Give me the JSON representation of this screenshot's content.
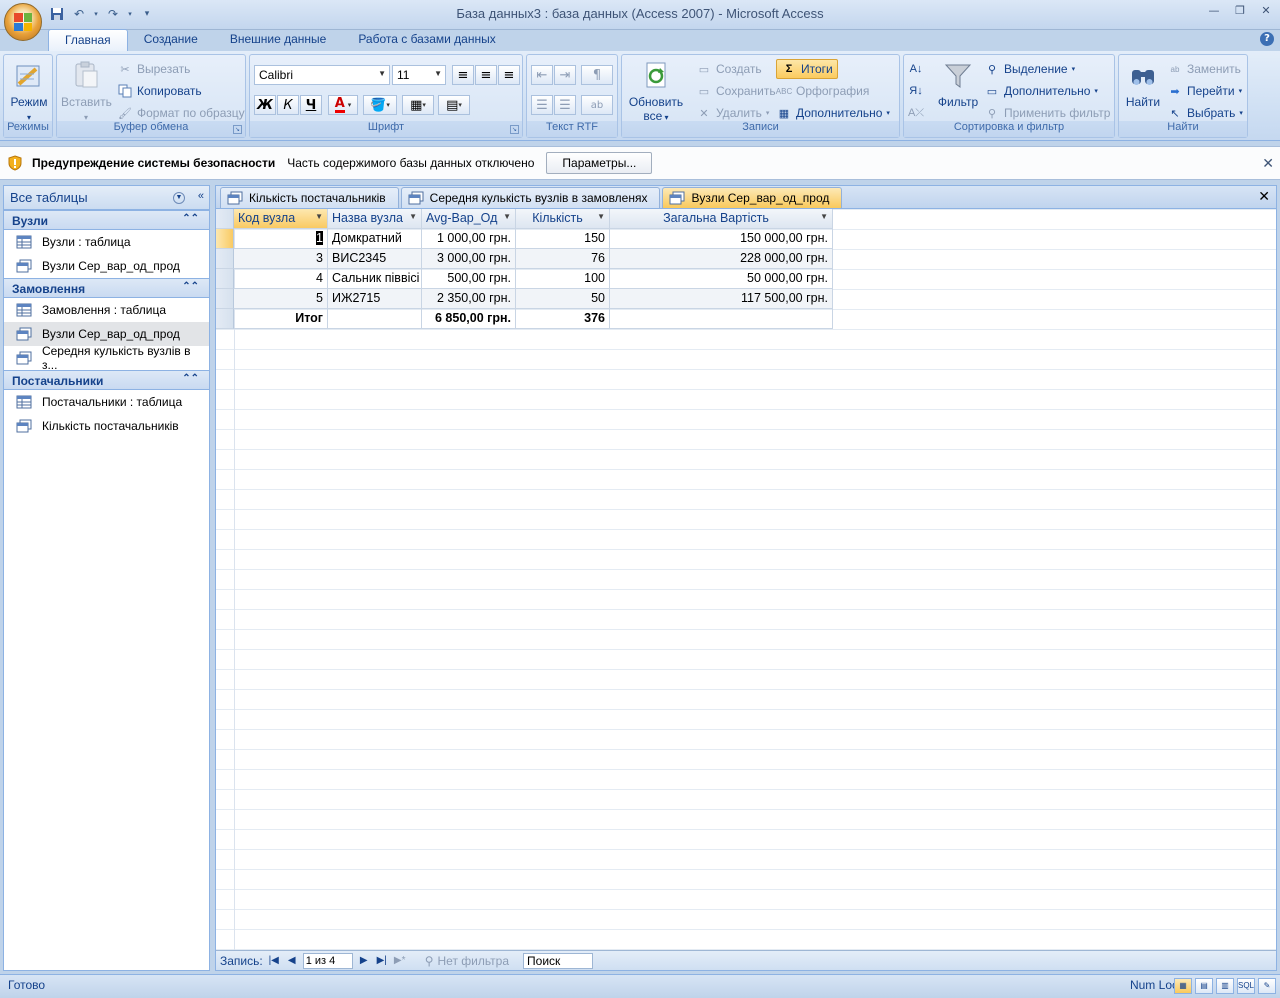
{
  "window": {
    "title": "База данных3 : база данных (Access 2007) - Microsoft Access"
  },
  "ribbon_tabs": [
    "Главная",
    "Создание",
    "Внешние данные",
    "Работа с базами данных"
  ],
  "ribbon": {
    "modes": {
      "view": "Режим",
      "title": "Режимы"
    },
    "clipboard": {
      "paste": "Вставить",
      "cut": "Вырезать",
      "copy": "Копировать",
      "format_painter": "Формат по образцу",
      "title": "Буфер обмена"
    },
    "font": {
      "name": "Calibri",
      "size": "11",
      "bold": "Ж",
      "italic": "К",
      "underline": "Ч",
      "color": "A",
      "title": "Шрифт"
    },
    "rtf": {
      "title": "Текст RTF"
    },
    "records": {
      "refresh_line1": "Обновить",
      "refresh_line2": "все",
      "new": "Создать",
      "save": "Сохранить",
      "delete": "Удалить",
      "totals": "Итоги",
      "spelling": "Орфография",
      "more": "Дополнительно",
      "title": "Записи"
    },
    "sort": {
      "filter": "Фильтр",
      "selection": "Выделение",
      "advanced": "Дополнительно",
      "apply": "Применить фильтр",
      "title": "Сортировка и фильтр"
    },
    "find": {
      "find": "Найти",
      "replace": "Заменить",
      "goto": "Перейти",
      "select": "Выбрать",
      "title": "Найти"
    }
  },
  "message_bar": {
    "title": "Предупреждение системы безопасности",
    "text": "Часть содержимого базы данных отключено",
    "button": "Параметры..."
  },
  "nav": {
    "header": "Все таблицы",
    "groups": [
      {
        "title": "Вузли",
        "items": [
          "Вузли : таблица",
          "Вузли Сер_вар_од_прод"
        ]
      },
      {
        "title": "Замовлення",
        "items": [
          "Замовлення : таблица",
          "Вузли Сер_вар_од_прод",
          "Середня кулькість вузлів в з..."
        ]
      },
      {
        "title": "Постачальники",
        "items": [
          "Постачальники : таблица",
          "Кількість постачальників"
        ]
      }
    ]
  },
  "doc_tabs": [
    "Кількість постачальників",
    "Середня кулькість вузлів в замовленях",
    "Вузли Сер_вар_од_прод"
  ],
  "grid": {
    "columns": [
      "Код вузла",
      "Назва вузла",
      "Avg-Вар_Од",
      "Кількість",
      "Загальна Вартість"
    ],
    "rows": [
      [
        "1",
        "Домкратний",
        "1 000,00 грн.",
        "150",
        "150 000,00 грн."
      ],
      [
        "3",
        "ВИС2345",
        "3 000,00 грн.",
        "76",
        "228 000,00 грн."
      ],
      [
        "4",
        "Сальник піввісі",
        "500,00 грн.",
        "100",
        "50 000,00 грн."
      ],
      [
        "5",
        "ИЖ2715",
        "2 350,00 грн.",
        "50",
        "117 500,00 грн."
      ]
    ],
    "totals": [
      "Итог",
      "",
      "6 850,00 грн.",
      "376",
      ""
    ]
  },
  "record_nav": {
    "label": "Запись:",
    "position": "1 из 4",
    "filter": "Нет фильтра",
    "search": "Поиск"
  },
  "status": {
    "text": "Готово",
    "numlock": "Num Lock"
  }
}
